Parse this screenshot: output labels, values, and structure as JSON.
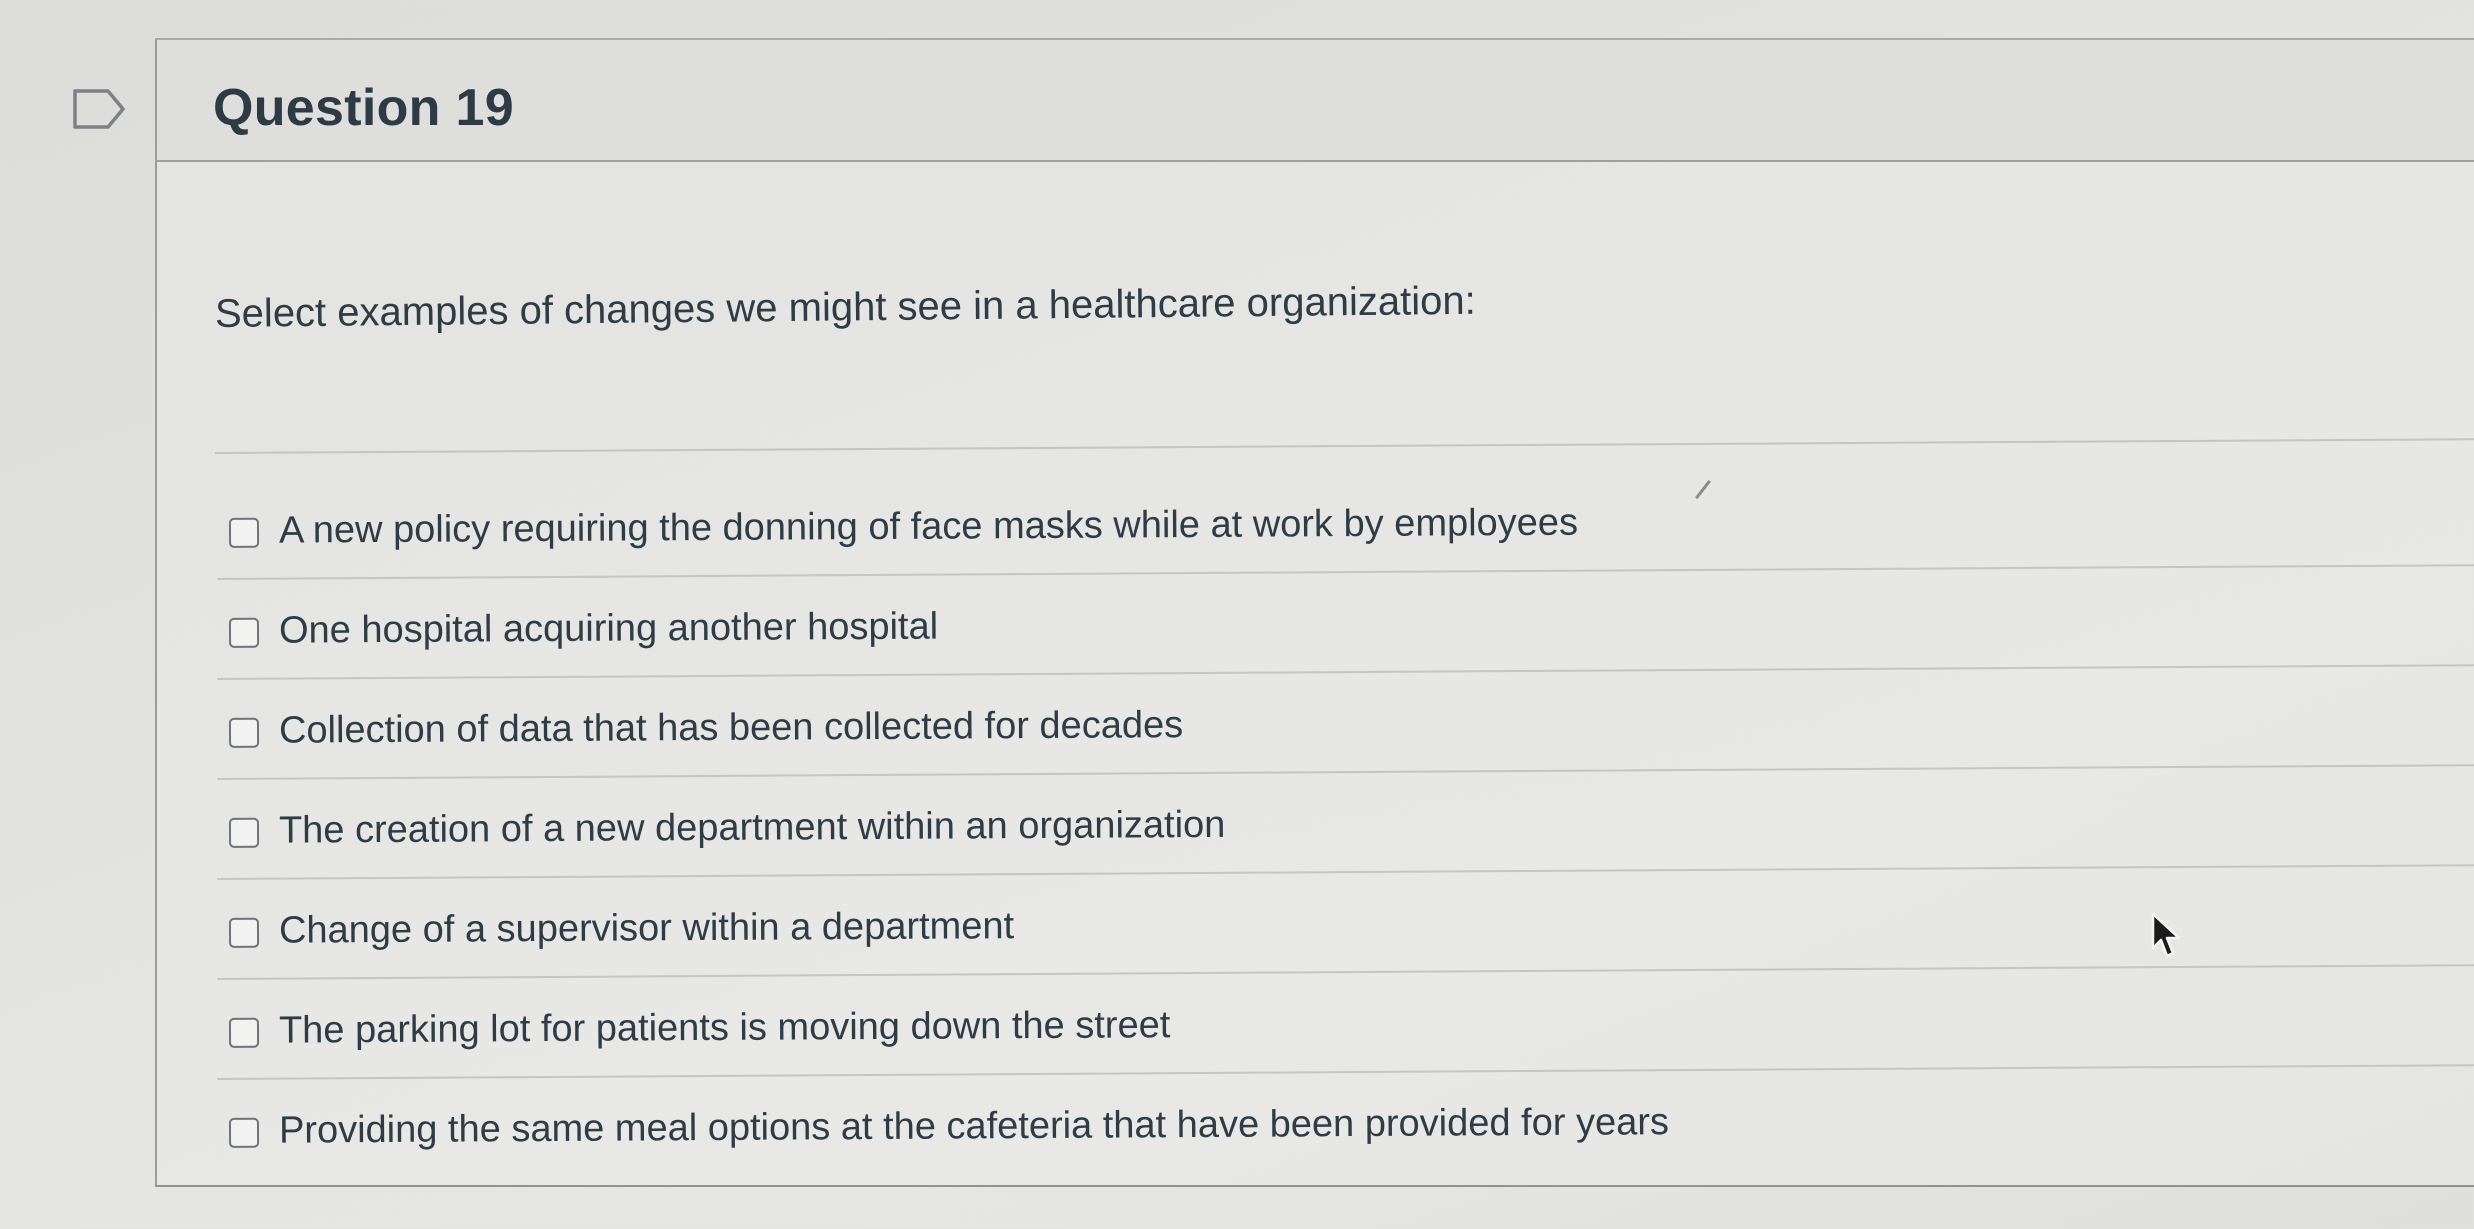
{
  "question": {
    "title": "Question 19",
    "prompt": "Select examples of changes we might see in a healthcare organization:",
    "answers": [
      "A new policy requiring the donning of face masks while at work by employees",
      "One hospital acquiring another hospital",
      "Collection of data that has been collected for decades",
      "The creation of a new department within an organization",
      "Change of a supervisor within a department",
      "The parking lot for patients is moving down the street",
      "Providing the same meal options at the cafeteria that have been provided for years"
    ]
  },
  "icons": {
    "flag": "flag-outline-icon",
    "cursor": "mouse-pointer-icon"
  },
  "colors": {
    "text": "#2f3c46",
    "border": "#9d9fa1",
    "checkbox_border": "#6e7479"
  }
}
